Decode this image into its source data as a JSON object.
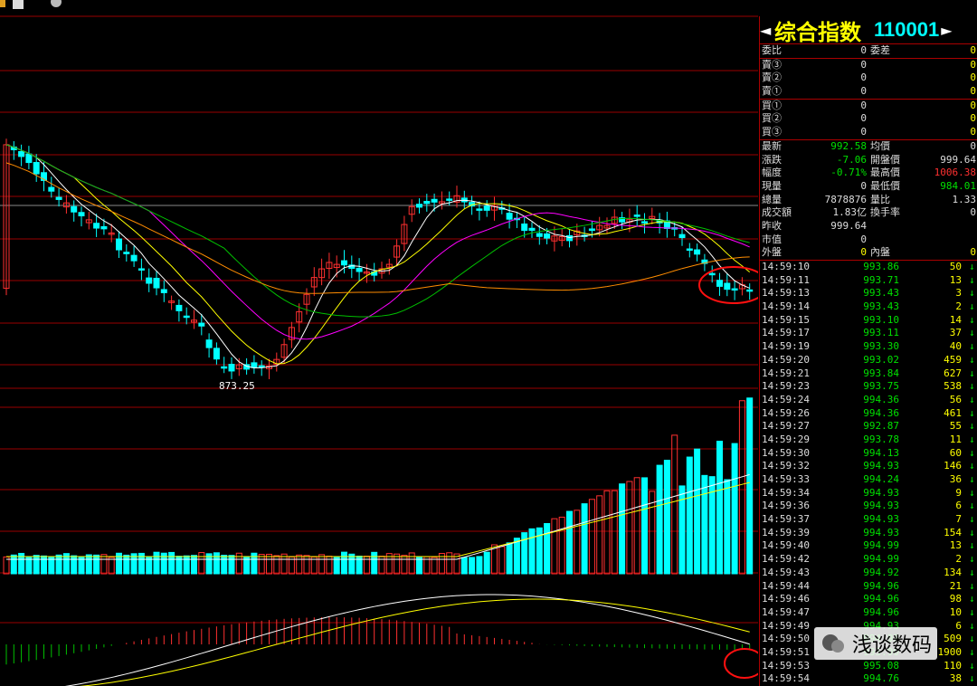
{
  "header": {
    "name": "综合指数",
    "code": "110001",
    "left_arrow": "◄",
    "right_arrow": "►"
  },
  "order_book": {
    "wei_bi": {
      "l1": "委比",
      "v1": "0",
      "l2": "委差",
      "v2": "0"
    },
    "sells": [
      {
        "label": "賣③",
        "v1": "0",
        "v2": "0"
      },
      {
        "label": "賣②",
        "v1": "0",
        "v2": "0"
      },
      {
        "label": "賣①",
        "v1": "0",
        "v2": "0"
      }
    ],
    "buys": [
      {
        "label": "買①",
        "v1": "0",
        "v2": "0"
      },
      {
        "label": "買②",
        "v1": "0",
        "v2": "0"
      },
      {
        "label": "買③",
        "v1": "0",
        "v2": "0"
      }
    ]
  },
  "quote": [
    {
      "l1": "最新",
      "v1": "992.58",
      "c1": "#00e000",
      "l2": "均價",
      "v2": "0",
      "c2": "#ddd"
    },
    {
      "l1": "漲跌",
      "v1": "-7.06",
      "c1": "#00e000",
      "l2": "開盤價",
      "v2": "999.64",
      "c2": "#ddd"
    },
    {
      "l1": "幅度",
      "v1": "-0.71%",
      "c1": "#00e000",
      "l2": "最高價",
      "v2": "1006.38",
      "c2": "#ff3030"
    },
    {
      "l1": "現量",
      "v1": "0",
      "c1": "#ddd",
      "l2": "最低價",
      "v2": "984.01",
      "c2": "#00e000"
    },
    {
      "l1": "總量",
      "v1": "7878876",
      "c1": "#ddd",
      "l2": "量比",
      "v2": "1.33",
      "c2": "#ddd"
    },
    {
      "l1": "成交額",
      "v1": "1.83亿",
      "c1": "#ddd",
      "l2": "換手率",
      "v2": "0",
      "c2": "#ddd"
    },
    {
      "l1": "昨收",
      "v1": "999.64",
      "c1": "#ddd",
      "l2": "",
      "v2": "",
      "c2": "#ddd"
    },
    {
      "l1": "市值",
      "v1": "0",
      "c1": "#ddd",
      "l2": "",
      "v2": "",
      "c2": "#ddd"
    },
    {
      "l1": "外盤",
      "v1": "0",
      "c1": "#ffff00",
      "l2": "內盤",
      "v2": "0",
      "c2": "#ffff00"
    }
  ],
  "ticks": [
    {
      "time": "14:59:10",
      "price": "993.86",
      "vol": "50"
    },
    {
      "time": "14:59:11",
      "price": "993.71",
      "vol": "13"
    },
    {
      "time": "14:59:13",
      "price": "993.43",
      "vol": "3"
    },
    {
      "time": "14:59:14",
      "price": "993.43",
      "vol": "2"
    },
    {
      "time": "14:59:15",
      "price": "993.10",
      "vol": "14"
    },
    {
      "time": "14:59:17",
      "price": "993.11",
      "vol": "37"
    },
    {
      "time": "14:59:19",
      "price": "993.30",
      "vol": "40"
    },
    {
      "time": "14:59:20",
      "price": "993.02",
      "vol": "459"
    },
    {
      "time": "14:59:21",
      "price": "993.84",
      "vol": "627"
    },
    {
      "time": "14:59:23",
      "price": "993.75",
      "vol": "538"
    },
    {
      "time": "14:59:24",
      "price": "994.36",
      "vol": "56"
    },
    {
      "time": "14:59:26",
      "price": "994.36",
      "vol": "461"
    },
    {
      "time": "14:59:27",
      "price": "992.87",
      "vol": "55"
    },
    {
      "time": "14:59:29",
      "price": "993.78",
      "vol": "11"
    },
    {
      "time": "14:59:30",
      "price": "994.13",
      "vol": "60"
    },
    {
      "time": "14:59:32",
      "price": "994.93",
      "vol": "146"
    },
    {
      "time": "14:59:33",
      "price": "994.24",
      "vol": "36"
    },
    {
      "time": "14:59:34",
      "price": "994.93",
      "vol": "9"
    },
    {
      "time": "14:59:36",
      "price": "994.93",
      "vol": "6"
    },
    {
      "time": "14:59:37",
      "price": "994.93",
      "vol": "7"
    },
    {
      "time": "14:59:39",
      "price": "994.93",
      "vol": "154"
    },
    {
      "time": "14:59:40",
      "price": "994.99",
      "vol": "13"
    },
    {
      "time": "14:59:42",
      "price": "994.99",
      "vol": "2"
    },
    {
      "time": "14:59:43",
      "price": "994.92",
      "vol": "134"
    },
    {
      "time": "14:59:44",
      "price": "994.96",
      "vol": "21"
    },
    {
      "time": "14:59:46",
      "price": "994.96",
      "vol": "98"
    },
    {
      "time": "14:59:47",
      "price": "994.96",
      "vol": "10"
    },
    {
      "time": "14:59:49",
      "price": "994.93",
      "vol": "6"
    },
    {
      "time": "14:59:50",
      "price": "994.93",
      "vol": "509"
    },
    {
      "time": "14:59:51",
      "price": "995.90",
      "vol": "1900"
    },
    {
      "time": "14:59:53",
      "price": "995.08",
      "vol": "110"
    },
    {
      "time": "14:59:54",
      "price": "994.76",
      "vol": "38"
    }
  ],
  "chart": {
    "low_label": "873.25"
  },
  "watermark": {
    "text": "浅谈数码"
  },
  "colors": {
    "up": "#ff3030",
    "down": "#00ffff",
    "grid": "#9a0000",
    "ma5": "#ffffff",
    "ma10": "#ffff00",
    "ma20": "#ff00ff",
    "ma30": "#00c000",
    "ma60": "#ff8c00"
  }
}
